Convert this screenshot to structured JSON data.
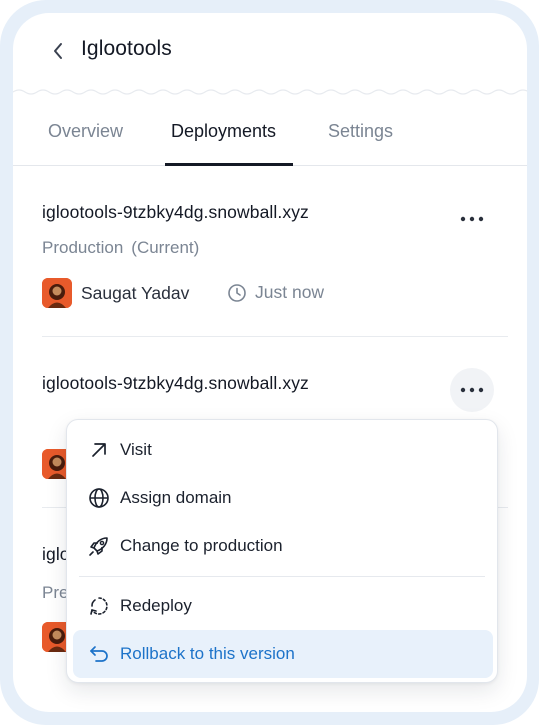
{
  "header": {
    "title": "Iglootools"
  },
  "tabs": [
    {
      "label": "Overview",
      "active": false
    },
    {
      "label": "Deployments",
      "active": true
    },
    {
      "label": "Settings",
      "active": false
    }
  ],
  "deployments": [
    {
      "url": "iglootools-9tzbky4dg.snowball.xyz",
      "environment": "Production",
      "status": "(Current)",
      "author": "Saugat Yadav",
      "time": "Just now"
    },
    {
      "url": "iglootools-9tzbky4dg.snowball.xyz"
    },
    {
      "url_partial": "iglo",
      "environment_partial": "Pre"
    }
  ],
  "menu": {
    "items": [
      {
        "label": "Visit",
        "icon": "arrow-up-right-icon"
      },
      {
        "label": "Assign domain",
        "icon": "globe-icon"
      },
      {
        "label": "Change to production",
        "icon": "rocket-icon"
      },
      {
        "label": "Redeploy",
        "icon": "redeploy-icon"
      },
      {
        "label": "Rollback to this version",
        "icon": "rollback-icon",
        "highlighted": true
      }
    ]
  },
  "colors": {
    "accent": "#1d73c9",
    "highlight_bg": "#e8f1fb",
    "avatar": "#e85a2b"
  }
}
